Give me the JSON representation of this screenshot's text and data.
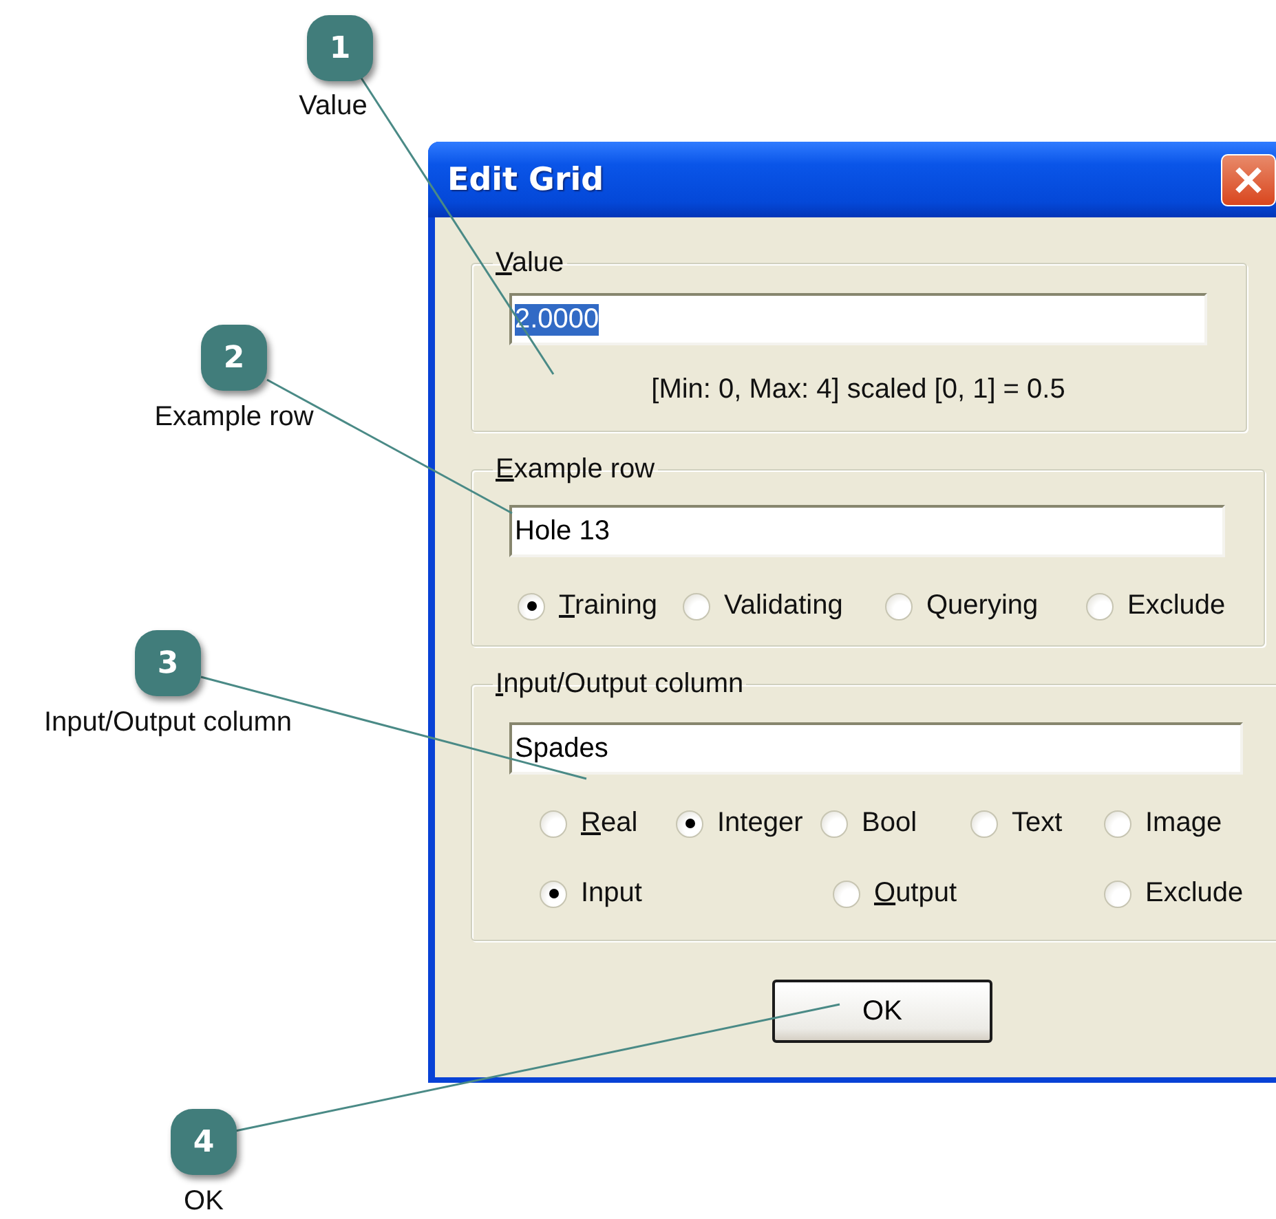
{
  "callouts": [
    {
      "number": "1",
      "label": "Value"
    },
    {
      "number": "2",
      "label": "Example row"
    },
    {
      "number": "3",
      "label": "Input/Output column"
    },
    {
      "number": "4",
      "label": "OK"
    }
  ],
  "window": {
    "title": "Edit Grid"
  },
  "value_group": {
    "legend": "Value",
    "mnemonic": true,
    "value": "2.0000",
    "text_selected": true,
    "range_text": "[Min: 0, Max: 4] scaled [0, 1] = 0.5"
  },
  "example_row_group": {
    "legend": "Example row",
    "mnemonic": true,
    "value": "Hole 13",
    "options": [
      {
        "label": "Training",
        "selected": true,
        "mnemonic": true
      },
      {
        "label": "Validating",
        "selected": false,
        "mnemonic": false
      },
      {
        "label": "Querying",
        "selected": false,
        "mnemonic": false
      },
      {
        "label": "Exclude",
        "selected": false,
        "mnemonic": false
      }
    ]
  },
  "io_column_group": {
    "legend": "Input/Output column",
    "mnemonic": true,
    "value": "Spades",
    "types": [
      {
        "label": "Real",
        "selected": false,
        "mnemonic": true
      },
      {
        "label": "Integer",
        "selected": true,
        "mnemonic": false
      },
      {
        "label": "Bool",
        "selected": false,
        "mnemonic": false
      },
      {
        "label": "Text",
        "selected": false,
        "mnemonic": false
      },
      {
        "label": "Image",
        "selected": false,
        "mnemonic": false
      }
    ],
    "roles": [
      {
        "label": "Input",
        "selected": true,
        "mnemonic": false
      },
      {
        "label": "Output",
        "selected": false,
        "mnemonic": true
      },
      {
        "label": "Exclude",
        "selected": false,
        "mnemonic": false
      }
    ]
  },
  "buttons": [
    {
      "label": "OK"
    }
  ]
}
